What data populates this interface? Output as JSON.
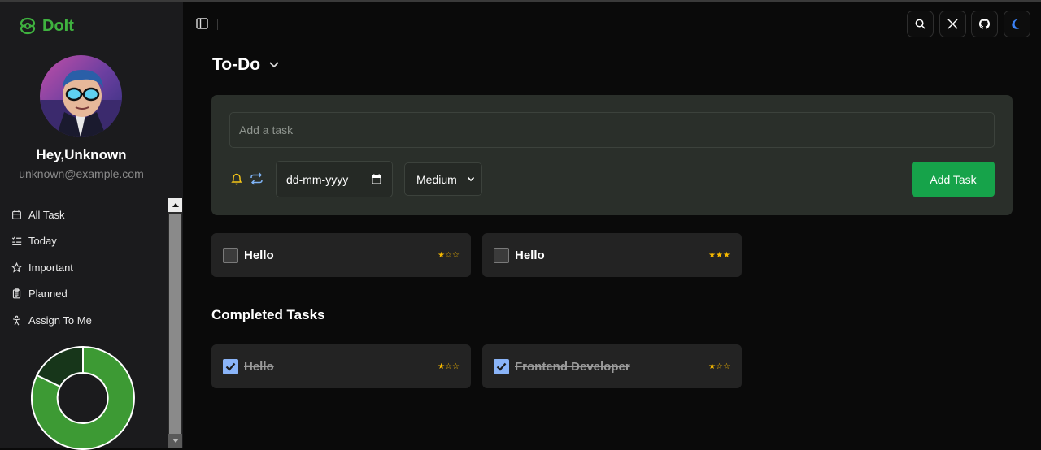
{
  "app": {
    "name": "DoIt",
    "brand_color": "#3fb23f"
  },
  "user": {
    "greeting": "Hey,Unknown",
    "email": "unknown@example.com"
  },
  "sidebar": {
    "items": [
      {
        "label": "All Task",
        "icon": "calendar-icon"
      },
      {
        "label": "Today",
        "icon": "list-check-icon"
      },
      {
        "label": "Important",
        "icon": "star-icon"
      },
      {
        "label": "Planned",
        "icon": "clipboard-icon"
      },
      {
        "label": "Assign To Me",
        "icon": "person-icon"
      }
    ],
    "chart_colors": {
      "completed": "#3d9a34",
      "pending": "#17361a"
    }
  },
  "header": {
    "buttons": [
      "search-icon",
      "x-twitter-icon",
      "github-icon",
      "moon-icon"
    ]
  },
  "main": {
    "title": "To-Do",
    "add_task": {
      "placeholder": "Add a task",
      "date_placeholder": "dd-mm-yyyy",
      "priority": "Medium",
      "button_label": "Add Task"
    },
    "tasks": [
      {
        "title": "Hello",
        "stars": "★☆☆",
        "completed": false
      },
      {
        "title": "Hello",
        "stars": "★★★",
        "completed": false
      }
    ],
    "completed_heading": "Completed Tasks",
    "completed_tasks": [
      {
        "title": "Hello",
        "stars": "★☆☆",
        "completed": true
      },
      {
        "title": "Frontend Developer",
        "stars": "★☆☆",
        "completed": true
      }
    ]
  }
}
